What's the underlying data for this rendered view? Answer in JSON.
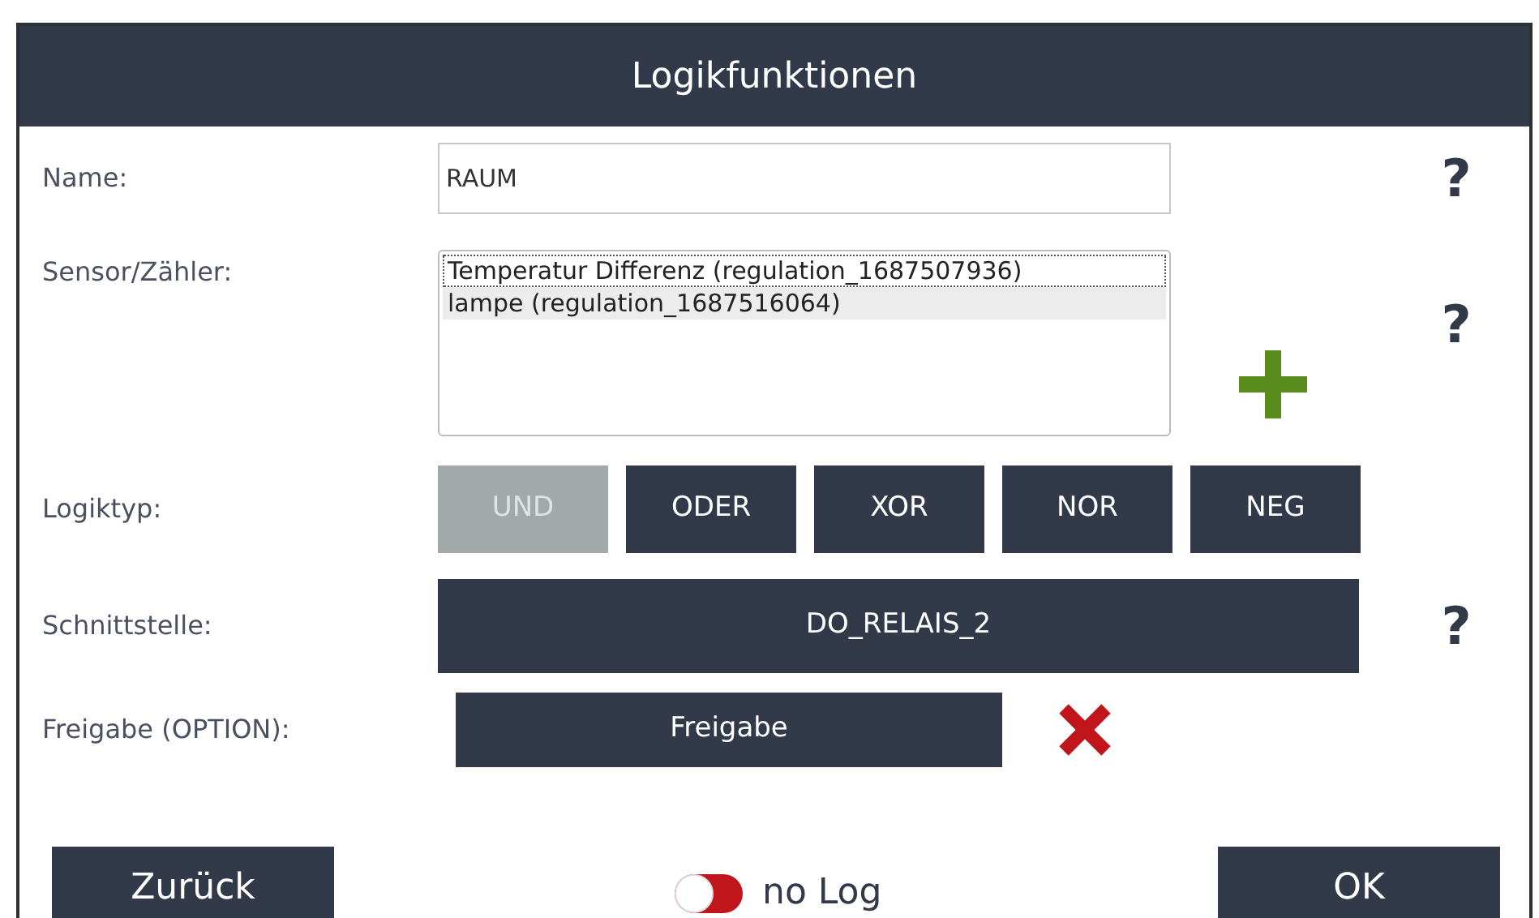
{
  "window": {
    "title": "Logikfunktionen"
  },
  "name": {
    "label": "Name:",
    "value": "RAUM"
  },
  "sensor": {
    "label": "Sensor/Zähler:",
    "items": [
      {
        "text": "Temperatur Differenz (regulation_1687507936)",
        "selected": false,
        "focused": true
      },
      {
        "text": "lampe (regulation_1687516064)",
        "selected": true,
        "focused": false
      }
    ]
  },
  "logic_type": {
    "label": "Logiktyp:",
    "options": [
      {
        "label": "UND",
        "selected": true
      },
      {
        "label": "ODER",
        "selected": false
      },
      {
        "label": "XOR",
        "selected": false
      },
      {
        "label": "NOR",
        "selected": false
      },
      {
        "label": "NEG",
        "selected": false
      }
    ]
  },
  "interface": {
    "label": "Schnittstelle:",
    "value": "DO_RELAIS_2"
  },
  "release": {
    "label": "Freigabe (OPTION):",
    "button": "Freigabe"
  },
  "help_marks": [
    "?",
    "?",
    "?"
  ],
  "footer": {
    "back": "Zurück",
    "log_toggle": {
      "on": false,
      "label": "no Log"
    },
    "ok": "OK"
  }
}
